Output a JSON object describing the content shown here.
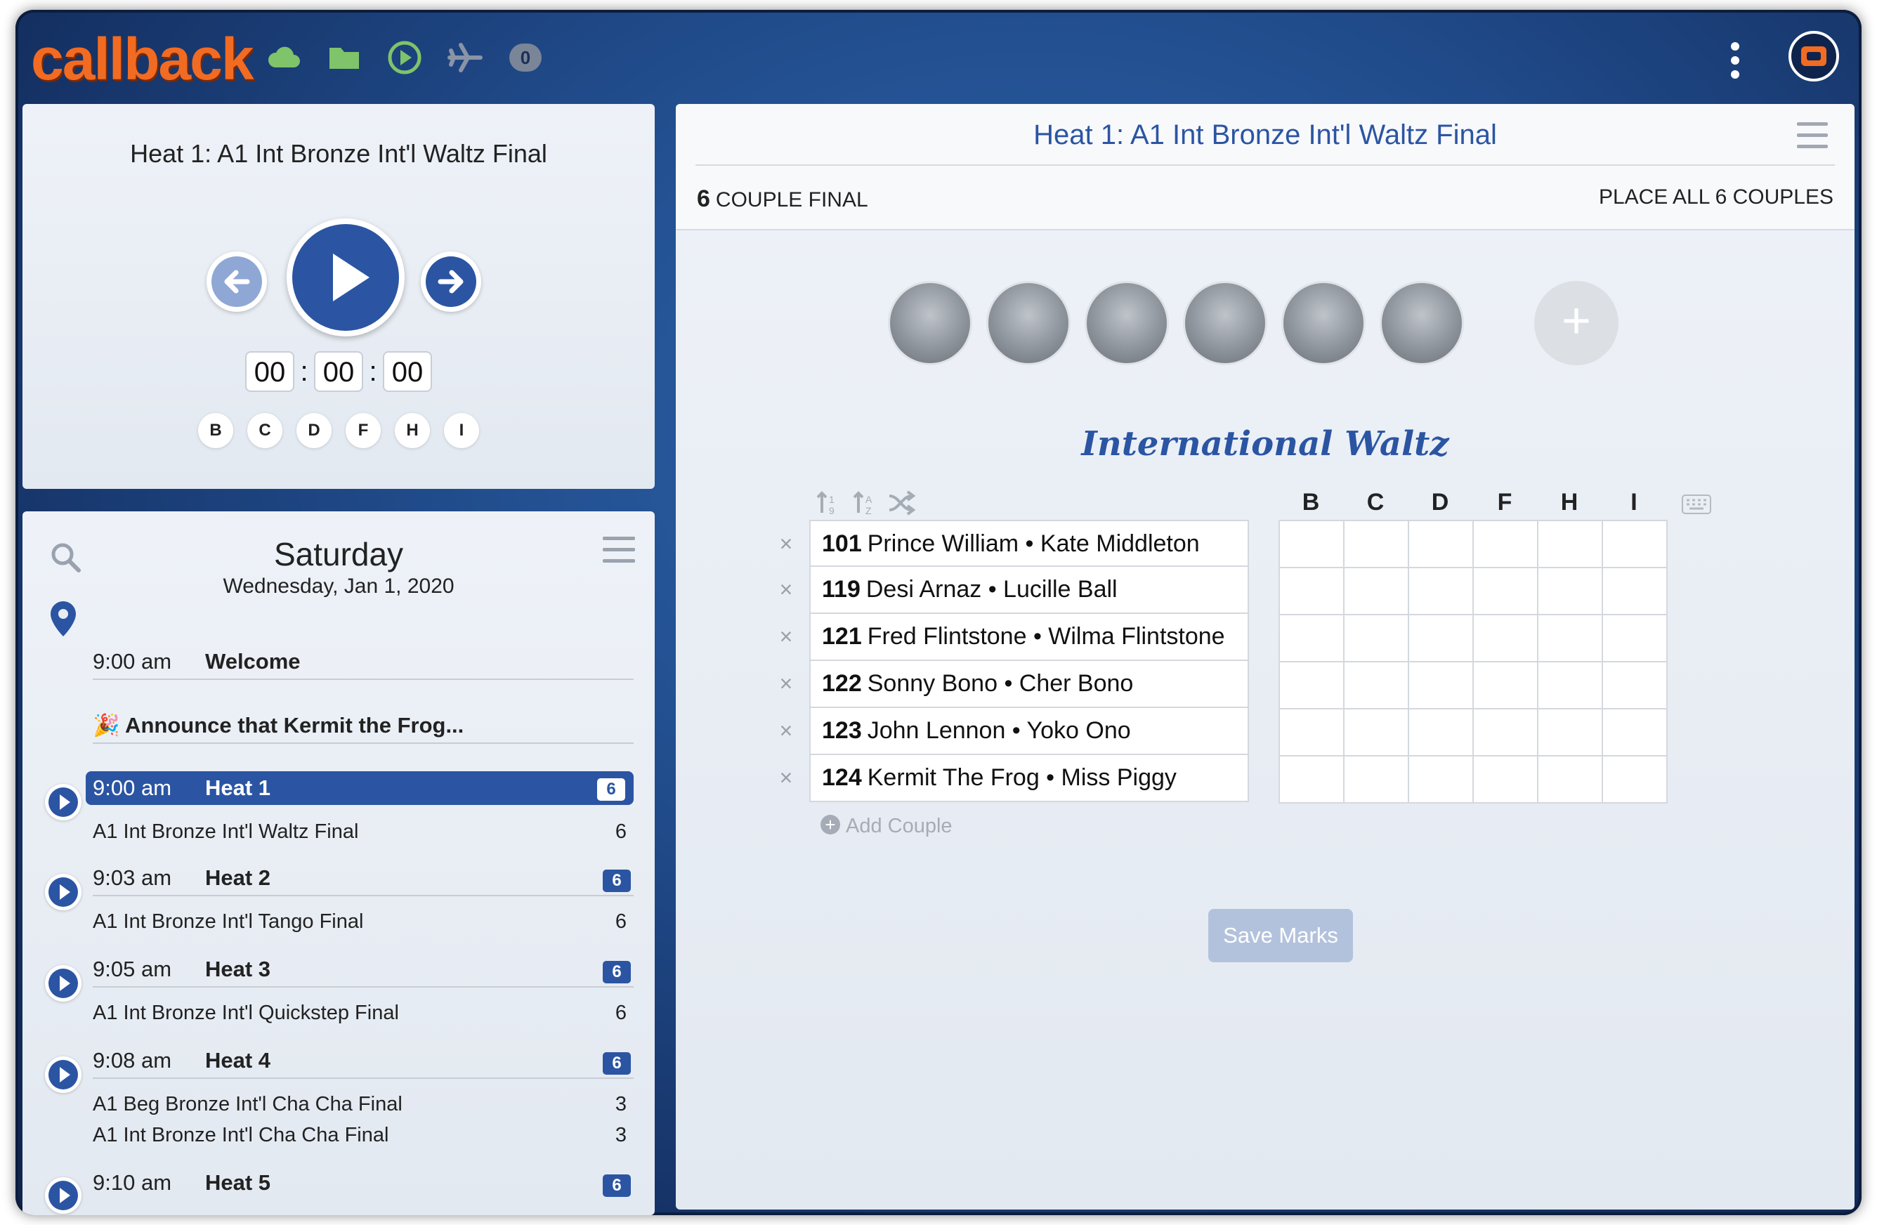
{
  "app": {
    "logo_text": "callback",
    "brand_color": "#f26b22",
    "accent_color": "#2b55a3"
  },
  "topbar": {
    "icons": [
      "cloud-icon",
      "folder-icon",
      "play-circle-icon",
      "airplane-icon",
      "count-badge-icon"
    ],
    "badge_count": "0"
  },
  "player": {
    "title": "Heat 1: A1 Int Bronze Int'l Waltz Final",
    "timer": {
      "hours": "00",
      "minutes": "00",
      "seconds": "00",
      "sep": ":"
    },
    "judges": [
      "B",
      "C",
      "D",
      "F",
      "H",
      "I"
    ]
  },
  "schedule": {
    "day": "Saturday",
    "date": "Wednesday, Jan 1, 2020",
    "items": [
      {
        "time": "9:00 am",
        "title": "Welcome"
      },
      {
        "title": "🎉 Announce that Kermit the Frog..."
      },
      {
        "time": "9:00 am",
        "title": "Heat 1",
        "badge": "6",
        "subs": [
          {
            "name": "A1 Int Bronze Int'l Waltz Final",
            "count": "6"
          }
        ]
      },
      {
        "time": "9:03 am",
        "title": "Heat 2",
        "badge": "6",
        "subs": [
          {
            "name": "A1 Int Bronze Int'l Tango Final",
            "count": "6"
          }
        ]
      },
      {
        "time": "9:05 am",
        "title": "Heat 3",
        "badge": "6",
        "subs": [
          {
            "name": "A1 Int Bronze Int'l Quickstep Final",
            "count": "6"
          }
        ]
      },
      {
        "time": "9:08 am",
        "title": "Heat 4",
        "badge": "6",
        "subs": [
          {
            "name": "A1 Beg Bronze Int'l Cha Cha Final",
            "count": "3"
          },
          {
            "name": "A1 Int Bronze Int'l Cha Cha Final",
            "count": "3"
          }
        ]
      },
      {
        "time": "9:10 am",
        "title": "Heat 5",
        "badge": "6"
      }
    ]
  },
  "main": {
    "title": "Heat 1: A1 Int Bronze Int'l Waltz Final",
    "couple_count": "6",
    "couple_final_label": "COUPLE FINAL",
    "place_label": "PLACE ALL 6 COUPLES",
    "add_judge": "+",
    "dance": "International Waltz",
    "judge_columns": [
      "B",
      "C",
      "D",
      "F",
      "H",
      "I"
    ],
    "couples": [
      {
        "num": "101",
        "names": "Prince William • Kate Middleton",
        "remove": "×"
      },
      {
        "num": "119",
        "names": "Desi Arnaz • Lucille Ball",
        "remove": "×"
      },
      {
        "num": "121",
        "names": "Fred Flintstone • Wilma Flintstone",
        "remove": "×"
      },
      {
        "num": "122",
        "names": "Sonny Bono • Cher Bono",
        "remove": "×"
      },
      {
        "num": "123",
        "names": "John Lennon • Yoko Ono",
        "remove": "×"
      },
      {
        "num": "124",
        "names": "Kermit The Frog • Miss Piggy",
        "remove": "×"
      }
    ],
    "add_couple_icon": "+",
    "add_couple": "Add Couple",
    "save_button": "Save Marks"
  }
}
